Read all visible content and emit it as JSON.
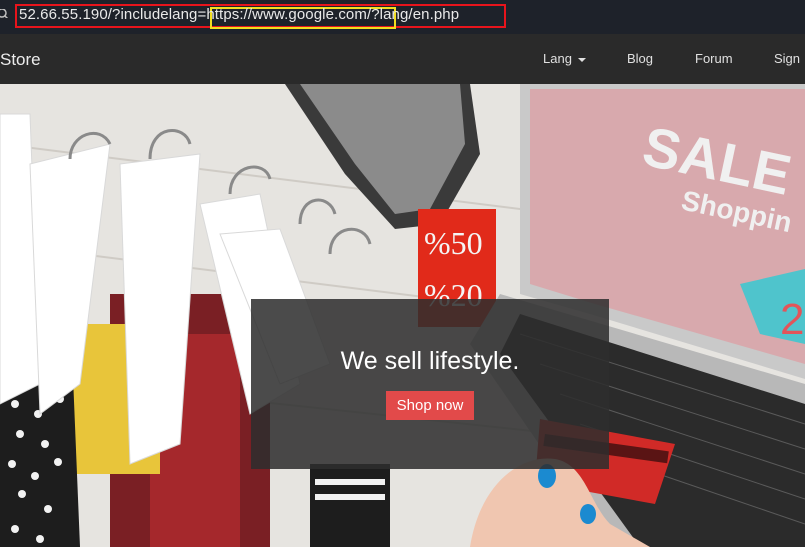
{
  "address_bar": {
    "url": "52.66.55.190/?includelang=https://www.google.com/?lang/en.php",
    "highlighted_part": "https://www.google.com/?",
    "icon": "search-icon"
  },
  "navbar": {
    "brand": "Store",
    "items": [
      {
        "label": "Lang",
        "icon": "caret-down-icon"
      },
      {
        "label": "Blog"
      },
      {
        "label": "Forum"
      },
      {
        "label": "Sign"
      }
    ]
  },
  "hero": {
    "tagline": "We sell lifestyle.",
    "button_label": "Shop now",
    "image": {
      "laptop_screen_text": [
        "SALE",
        "Shoppin",
        "2"
      ],
      "price_tag_text": [
        "%50",
        "%20"
      ]
    }
  },
  "colors": {
    "url_outline": "#e8141c",
    "highlight_outline": "#f2de1f",
    "nav_bg": "#2a2a2a",
    "button_bg": "#e24a4a"
  }
}
